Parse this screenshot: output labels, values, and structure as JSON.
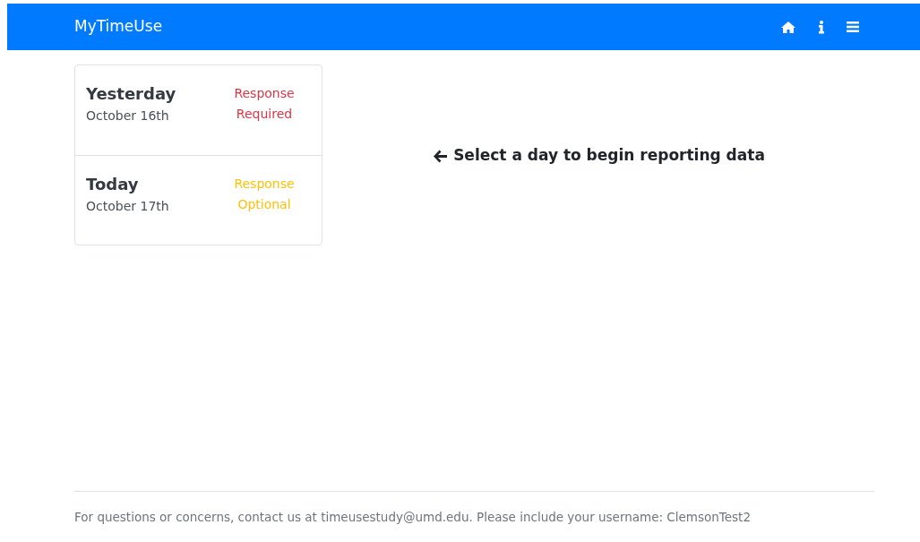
{
  "navbar": {
    "brand": "MyTimeUse"
  },
  "days": [
    {
      "title": "Yesterday",
      "date": "October 16th",
      "status": "Response Required",
      "color": "#dc3545"
    },
    {
      "title": "Today",
      "date": "October 17th",
      "status": "Response Optional",
      "color": "#ffc107"
    }
  ],
  "prompt": "Select a day to begin reporting data",
  "footer": "For questions or concerns, contact us at timeusestudy@umd.edu. Please include your username: ClemsonTest2"
}
